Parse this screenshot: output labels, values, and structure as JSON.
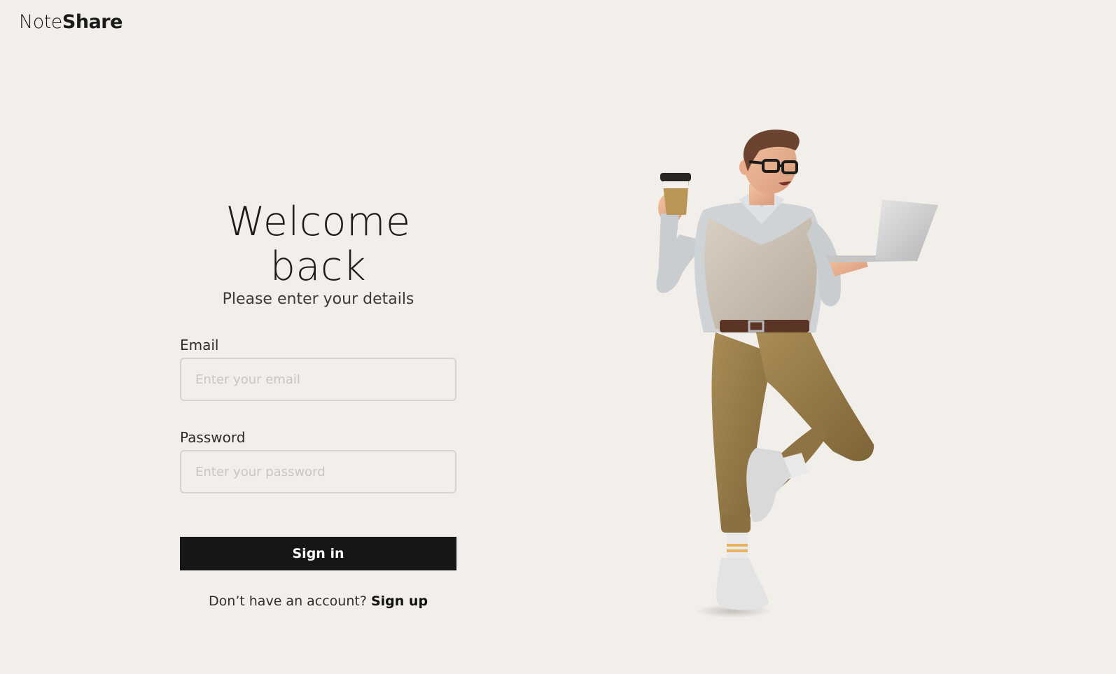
{
  "brand": {
    "name_light": "Note",
    "name_bold": "Share"
  },
  "login": {
    "title": "Welcome back",
    "subtitle": "Please enter your details",
    "email_label": "Email",
    "email_placeholder": "Enter your email",
    "email_value": "",
    "password_label": "Password",
    "password_placeholder": "Enter your password",
    "password_value": "",
    "submit_label": "Sign in",
    "signup_prompt": "Don’t have an account?",
    "signup_link": "Sign up"
  },
  "illustration": {
    "subject": "3d-man-with-coffee-and-laptop"
  },
  "colors": {
    "background": "#f2efeb",
    "button": "#161616",
    "button_text": "#ffffff",
    "input_border": "#d8d3cf"
  }
}
